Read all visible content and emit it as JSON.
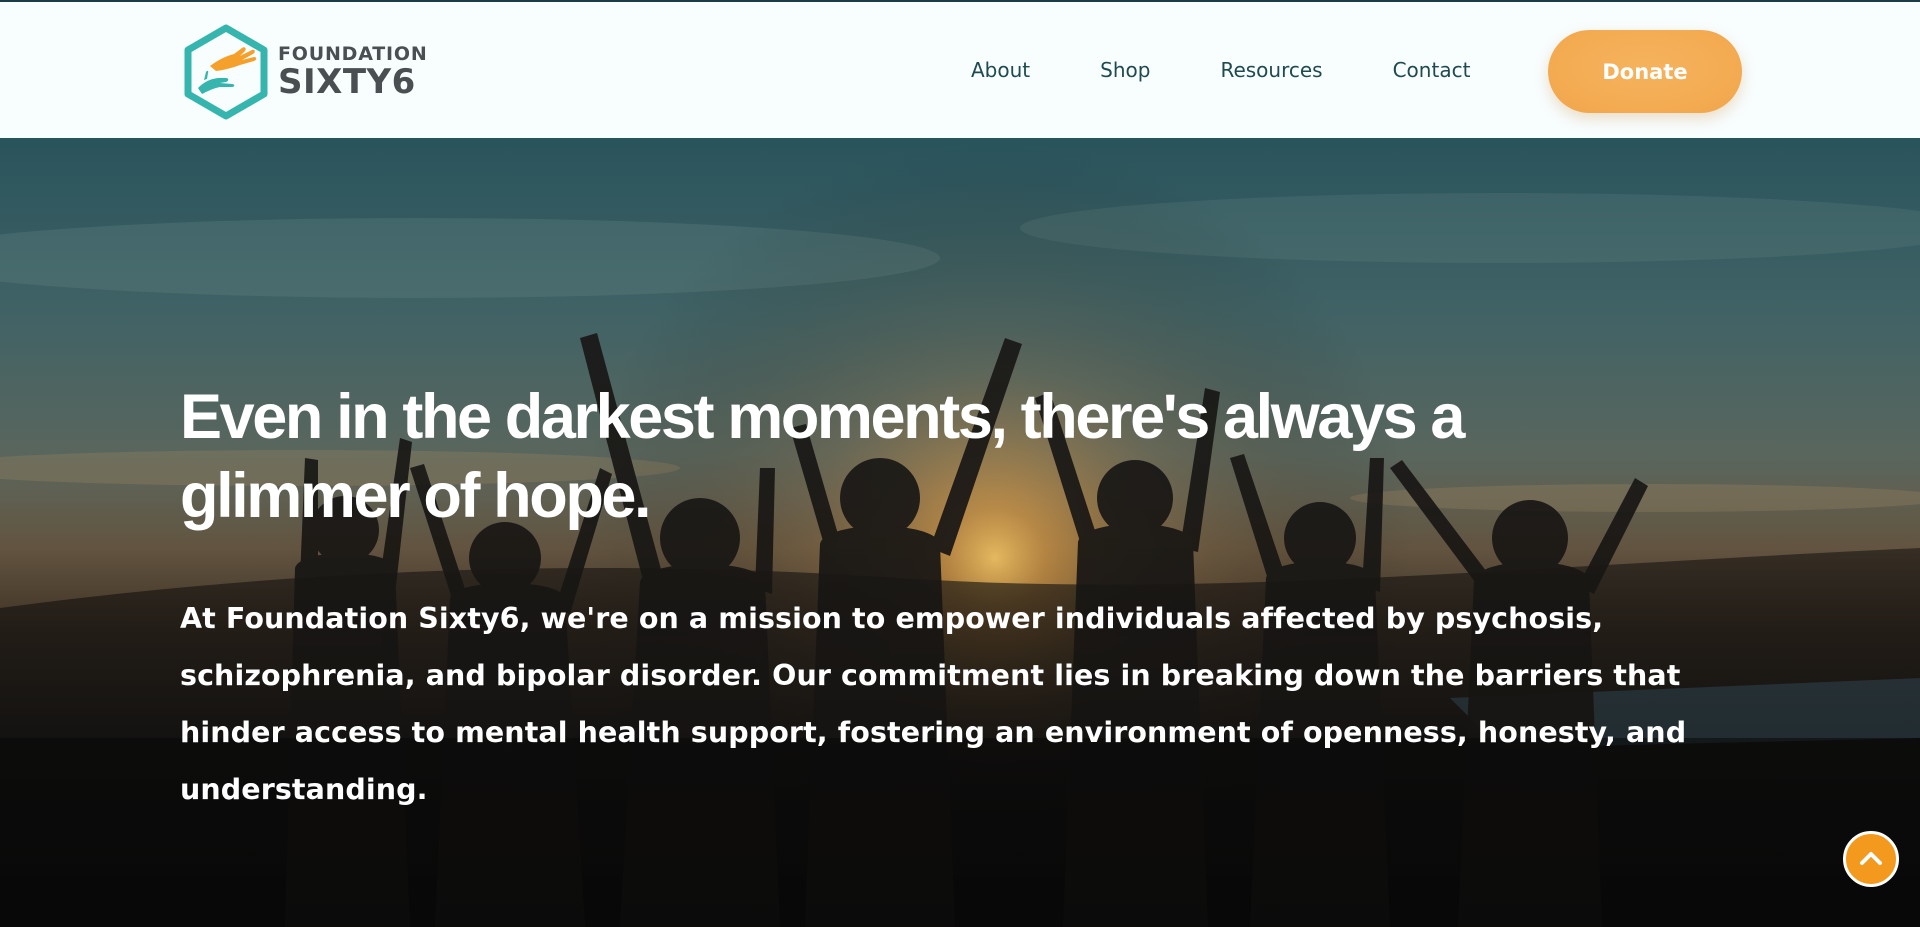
{
  "header": {
    "logo": {
      "line1": "FOUNDATION",
      "line2": "SIXTY6",
      "icon": "hexagon-hands-logo-icon"
    },
    "nav": [
      {
        "label": "About"
      },
      {
        "label": "Shop"
      },
      {
        "label": "Resources"
      },
      {
        "label": "Contact"
      }
    ],
    "donate_label": "Donate"
  },
  "hero": {
    "title": "Even in the darkest moments, there's always a glimmer of hope.",
    "body": "At Foundation Sixty6, we're on a mission to empower individuals affected by psychosis, schizophrenia, and bipolar disorder. Our commitment lies in breaking down the barriers that hinder access to mental health support, fostering an environment of openness, honesty, and understanding.",
    "background_image": "silhouettes-raised-hands-sunset-photo"
  },
  "scroll_top": {
    "icon": "chevron-up-icon"
  },
  "colors": {
    "accent_orange": "#F6B25C",
    "scroll_button": "#F39A1E",
    "nav_text": "#1F4A4F",
    "logo_teal": "#35B5AE",
    "logo_gray": "#4A4F52"
  }
}
